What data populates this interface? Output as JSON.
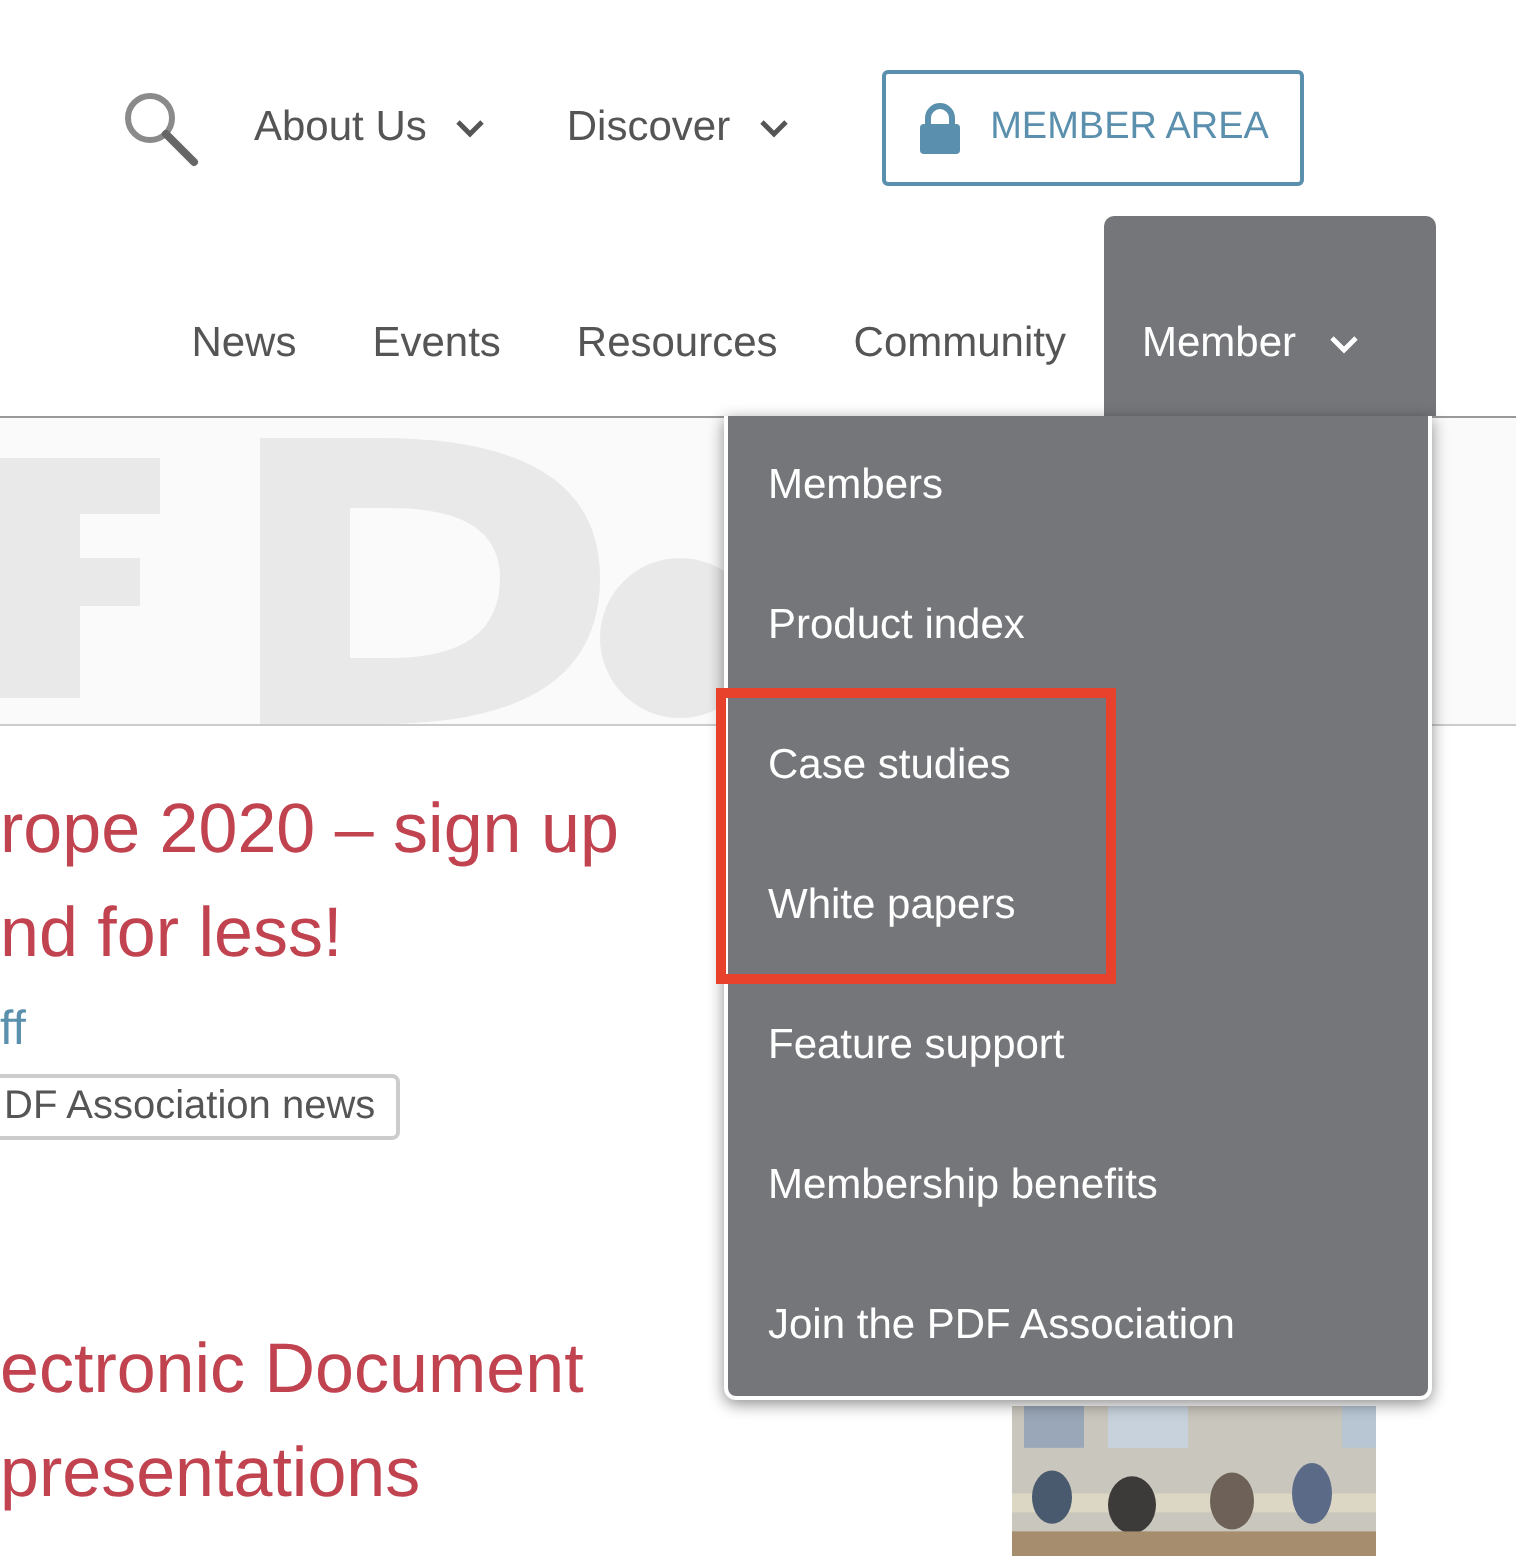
{
  "top_nav": {
    "items": [
      {
        "label": "About Us",
        "kind": "dropdown"
      },
      {
        "label": "Discover",
        "kind": "dropdown"
      }
    ],
    "member_button": "MEMBER AREA"
  },
  "main_nav": [
    {
      "label": "News",
      "selected": false,
      "kind": "link"
    },
    {
      "label": "Events",
      "selected": false,
      "kind": "link"
    },
    {
      "label": "Resources",
      "selected": false,
      "kind": "link"
    },
    {
      "label": "Community",
      "selected": false,
      "kind": "link"
    },
    {
      "label": "Member",
      "selected": true,
      "kind": "dropdown"
    }
  ],
  "dropdown": [
    {
      "label": "Members",
      "highlighted": false
    },
    {
      "label": "Product index",
      "highlighted": false
    },
    {
      "label": "Case studies",
      "highlighted": true
    },
    {
      "label": "White papers",
      "highlighted": true
    },
    {
      "label": "Feature support",
      "highlighted": false
    },
    {
      "label": "Membership benefits",
      "highlighted": false
    },
    {
      "label": "Join the PDF Association",
      "highlighted": false
    }
  ],
  "articles": [
    {
      "title_lines": [
        "rope 2020 – sign up",
        "nd for less!"
      ],
      "author": "ff",
      "tag": "DF Association news"
    },
    {
      "title_lines": [
        "ectronic Document",
        "presentations"
      ]
    }
  ]
}
